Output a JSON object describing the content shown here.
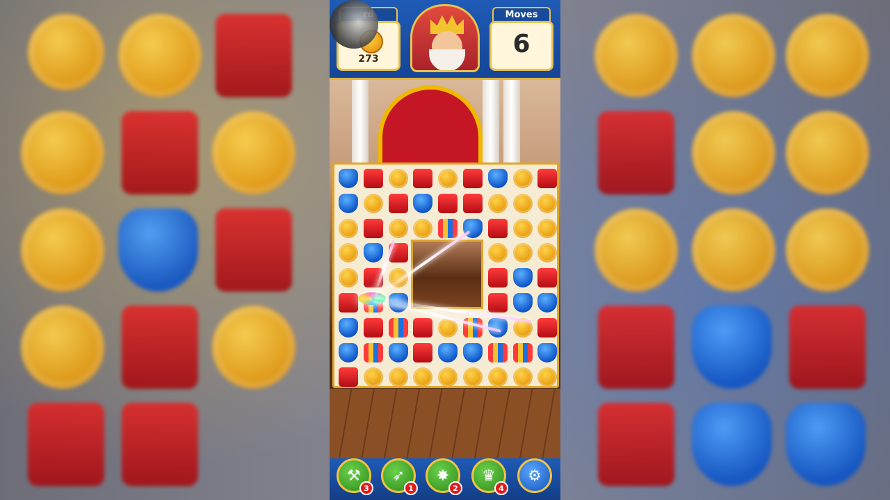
{
  "header": {
    "goal_label": "rd",
    "goal_count": "273",
    "moves_label": "Moves",
    "moves_value": "6"
  },
  "boosters": [
    {
      "name": "hammer",
      "icon": "hammer-icon",
      "count": "3"
    },
    {
      "name": "arrow",
      "icon": "bow-icon",
      "count": "1"
    },
    {
      "name": "cannon",
      "icon": "cannon-icon",
      "count": "2"
    },
    {
      "name": "jester-hat",
      "icon": "jester-hat-icon",
      "count": "4"
    }
  ],
  "settings_icon": "gear-icon",
  "colors": {
    "coin": "#f2a81a",
    "book": "#d81a1f",
    "shield": "#1e6fe0",
    "frame": "#e0a628",
    "bar": "#1f5bb6"
  },
  "board": {
    "rows": [
      [
        "shield",
        "book",
        "coin",
        "book",
        "coin",
        "book",
        "shield",
        "coin",
        "book"
      ],
      [
        "shield",
        "coin",
        "book",
        "shield",
        "book",
        "book",
        "coin",
        "coin",
        "coin"
      ],
      [
        "coin",
        "book",
        "coin",
        "coin",
        "special",
        "shield",
        "book",
        "coin",
        "coin"
      ],
      [
        "coin",
        "shield",
        "book",
        "",
        "",
        "",
        "coin",
        "coin",
        "coin"
      ],
      [
        "coin",
        "book",
        "coin",
        "",
        "",
        "",
        "book",
        "shield",
        "book"
      ],
      [
        "book",
        "special",
        "shield",
        "",
        "",
        "",
        "book",
        "shield",
        "shield"
      ],
      [
        "shield",
        "book",
        "special",
        "book",
        "coin",
        "special",
        "shield",
        "coin",
        "book"
      ],
      [
        "shield",
        "special",
        "shield",
        "book",
        "shield",
        "shield",
        "special",
        "special",
        "shield"
      ],
      [
        "book",
        "coin",
        "coin",
        "coin",
        "coin",
        "coin",
        "coin",
        "coin",
        "coin"
      ]
    ]
  }
}
